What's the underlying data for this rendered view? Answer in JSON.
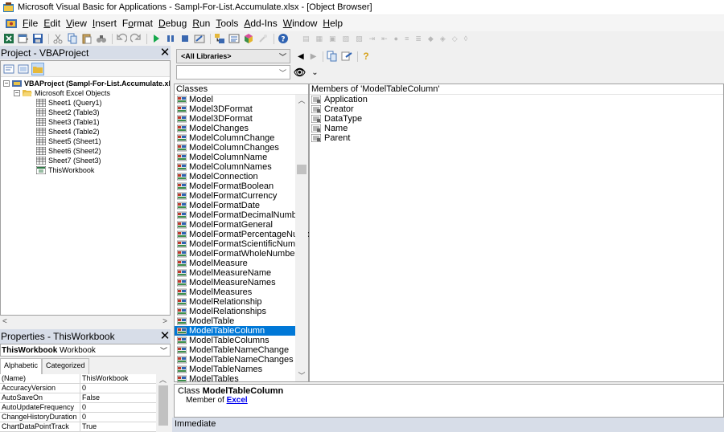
{
  "window": {
    "title": "Microsoft Visual Basic for Applications - Sampl-For-List.Accumulate.xlsx - [Object Browser]"
  },
  "menu": [
    {
      "pre": "",
      "ul": "F",
      "post": "ile"
    },
    {
      "pre": "",
      "ul": "E",
      "post": "dit"
    },
    {
      "pre": "",
      "ul": "V",
      "post": "iew"
    },
    {
      "pre": "",
      "ul": "I",
      "post": "nsert"
    },
    {
      "pre": "F",
      "ul": "o",
      "post": "rmat"
    },
    {
      "pre": "",
      "ul": "D",
      "post": "ebug"
    },
    {
      "pre": "",
      "ul": "R",
      "post": "un"
    },
    {
      "pre": "",
      "ul": "T",
      "post": "ools"
    },
    {
      "pre": "",
      "ul": "A",
      "post": "dd-Ins"
    },
    {
      "pre": "",
      "ul": "W",
      "post": "indow"
    },
    {
      "pre": "",
      "ul": "H",
      "post": "elp"
    }
  ],
  "project": {
    "title": "Project - VBAProject",
    "root": "VBAProject (Sampl-For-List.Accumulate.xlsx)",
    "folder": "Microsoft Excel Objects",
    "sheets": [
      "Sheet1 (Query1)",
      "Sheet2 (Table3)",
      "Sheet3 (Table1)",
      "Sheet4 (Table2)",
      "Sheet5 (Sheet1)",
      "Sheet6 (Sheet2)",
      "Sheet7 (Sheet3)"
    ],
    "workbook": "ThisWorkbook"
  },
  "properties": {
    "title": "Properties - ThisWorkbook",
    "object_name": "ThisWorkbook",
    "object_type": "Workbook",
    "tabs": [
      "Alphabetic",
      "Categorized"
    ],
    "rows": [
      {
        "k": "(Name)",
        "v": "ThisWorkbook"
      },
      {
        "k": "AccuracyVersion",
        "v": "0"
      },
      {
        "k": "AutoSaveOn",
        "v": "False"
      },
      {
        "k": "AutoUpdateFrequency",
        "v": "0"
      },
      {
        "k": "ChangeHistoryDuration",
        "v": "0"
      },
      {
        "k": "ChartDataPointTrack",
        "v": "True"
      }
    ]
  },
  "object_browser": {
    "library": "<All Libraries>",
    "search_value": "",
    "classes_header": "Classes",
    "classes": [
      "Model",
      "Model3DFormat",
      "Model3DFormat",
      "ModelChanges",
      "ModelColumnChange",
      "ModelColumnChanges",
      "ModelColumnName",
      "ModelColumnNames",
      "ModelConnection",
      "ModelFormatBoolean",
      "ModelFormatCurrency",
      "ModelFormatDate",
      "ModelFormatDecimalNumber",
      "ModelFormatGeneral",
      "ModelFormatPercentageNumber",
      "ModelFormatScientificNumber",
      "ModelFormatWholeNumber",
      "ModelMeasure",
      "ModelMeasureName",
      "ModelMeasureNames",
      "ModelMeasures",
      "ModelRelationship",
      "ModelRelationships",
      "ModelTable",
      "ModelTableColumn",
      "ModelTableColumns",
      "ModelTableNameChange",
      "ModelTableNameChanges",
      "ModelTableNames",
      "ModelTables"
    ],
    "selected_class": "ModelTableColumn",
    "members_header": "Members of 'ModelTableColumn'",
    "members": [
      "Application",
      "Creator",
      "DataType",
      "Name",
      "Parent"
    ],
    "detail": {
      "prefix": "Class",
      "name": "ModelTableColumn",
      "member_of": "Member of",
      "library": "Excel"
    }
  },
  "immediate": {
    "title": "Immediate"
  }
}
